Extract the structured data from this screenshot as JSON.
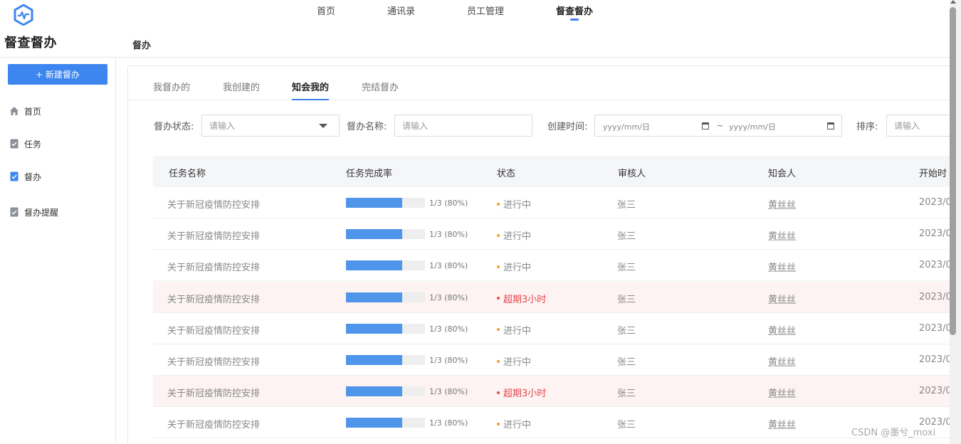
{
  "app": {
    "title": "督查督办",
    "logo_icon": "pulse-shield-icon",
    "brand_color": "#3d86ef"
  },
  "topnav": {
    "items": [
      {
        "label": "首页"
      },
      {
        "label": "通讯录"
      },
      {
        "label": "员工管理"
      },
      {
        "label": "督查督办",
        "active": true
      }
    ]
  },
  "breadcrumb": {
    "current": "督办"
  },
  "sidebar": {
    "new_button": "+ 新建督办",
    "items": [
      {
        "label": "首页",
        "icon": "home-icon"
      },
      {
        "label": "任务",
        "icon": "task-doc-icon"
      },
      {
        "label": "督办",
        "icon": "supervise-doc-icon",
        "active": true
      },
      {
        "label": "督办提醒",
        "icon": "reminder-doc-icon"
      }
    ]
  },
  "tabs": [
    {
      "label": "我督办的"
    },
    {
      "label": "我创建的"
    },
    {
      "label": "知会我的",
      "active": true
    },
    {
      "label": "完结督办"
    }
  ],
  "filters": {
    "status_label": "督办状态:",
    "status_placeholder": "请输入",
    "name_label": "督办名称:",
    "name_placeholder": "请输入",
    "created_label": "创建时间:",
    "date_start": "yyyy/mm/日",
    "date_sep": "~",
    "date_end": "yyyy/mm/日",
    "sort_label": "排序:",
    "sort_placeholder": "请输入"
  },
  "table": {
    "headers": [
      "任务名称",
      "任务完成率",
      "状态",
      "审核人",
      "知会人",
      "开始时"
    ],
    "rows": [
      {
        "name": "关于新冠疫情防控安排",
        "progress_text": "1/3 (80%)",
        "progress": 0.8,
        "status": "进行中",
        "status_type": "running",
        "reviewer": "张三",
        "cc": "黄丝丝",
        "start": "2023/0"
      },
      {
        "name": "关于新冠疫情防控安排",
        "progress_text": "1/3 (80%)",
        "progress": 0.8,
        "status": "进行中",
        "status_type": "running",
        "reviewer": "张三",
        "cc": "黄丝丝",
        "start": "2023/0"
      },
      {
        "name": "关于新冠疫情防控安排",
        "progress_text": "1/3 (80%)",
        "progress": 0.8,
        "status": "进行中",
        "status_type": "running",
        "reviewer": "张三",
        "cc": "黄丝丝",
        "start": "2023/0"
      },
      {
        "name": "关于新冠疫情防控安排",
        "progress_text": "1/3 (80%)",
        "progress": 0.8,
        "status": "超期3小时",
        "status_type": "overdue",
        "reviewer": "张三",
        "cc": "黄丝丝",
        "start": "2023/0"
      },
      {
        "name": "关于新冠疫情防控安排",
        "progress_text": "1/3 (80%)",
        "progress": 0.8,
        "status": "进行中",
        "status_type": "running",
        "reviewer": "张三",
        "cc": "黄丝丝",
        "start": "2023/0"
      },
      {
        "name": "关于新冠疫情防控安排",
        "progress_text": "1/3 (80%)",
        "progress": 0.8,
        "status": "进行中",
        "status_type": "running",
        "reviewer": "张三",
        "cc": "黄丝丝",
        "start": "2023/0"
      },
      {
        "name": "关于新冠疫情防控安排",
        "progress_text": "1/3 (80%)",
        "progress": 0.8,
        "status": "超期3小时",
        "status_type": "overdue",
        "reviewer": "张三",
        "cc": "黄丝丝",
        "start": "2023/0"
      },
      {
        "name": "关于新冠疫情防控安排",
        "progress_text": "1/3 (80%)",
        "progress": 0.8,
        "status": "进行中",
        "status_type": "running",
        "reviewer": "张三",
        "cc": "黄丝丝",
        "start": "2023/0"
      }
    ]
  },
  "colors": {
    "running_dot": "#f0a21f",
    "overdue": "#e5484d",
    "progress_fill": "#4f95ea"
  },
  "watermark": "CSDN @墨兮_moxi"
}
